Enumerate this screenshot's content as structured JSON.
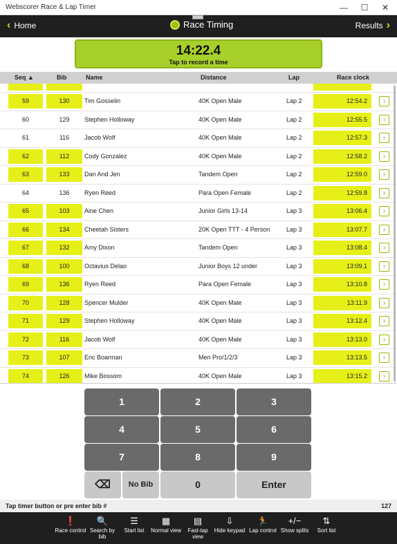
{
  "window": {
    "title": "Webscorer Race & Lap Timer",
    "minimize": "—",
    "maximize": "☐",
    "close": "✕"
  },
  "appbar": {
    "home_label": "Home",
    "title": "Race Timing",
    "results_label": "Results"
  },
  "timer": {
    "time": "14:22.4",
    "instruction": "Tap to record a time"
  },
  "table": {
    "headers": {
      "seq": "Seq ▲",
      "bib": "Bib",
      "name": "Name",
      "distance": "Distance",
      "lap": "Lap",
      "clock": "Race clock"
    },
    "rows": [
      {
        "seq": "59",
        "bib": "130",
        "name": "Tim Gosselin",
        "distance": "40K Open Male",
        "lap": "Lap 2",
        "clock": "12:54.2",
        "hl": true
      },
      {
        "seq": "60",
        "bib": "129",
        "name": "Stephen Holloway",
        "distance": "40K Open Male",
        "lap": "Lap 2",
        "clock": "12:55.5",
        "hl": false
      },
      {
        "seq": "61",
        "bib": "116",
        "name": "Jacob Wolf",
        "distance": "40K Open Male",
        "lap": "Lap 2",
        "clock": "12:57.3",
        "hl": false
      },
      {
        "seq": "62",
        "bib": "112",
        "name": "Cody Gonzalez",
        "distance": "40K Open Male",
        "lap": "Lap 2",
        "clock": "12:58.2",
        "hl": true
      },
      {
        "seq": "63",
        "bib": "133",
        "name": "Dan And Jen",
        "distance": "Tandem Open",
        "lap": "Lap 2",
        "clock": "12:59.0",
        "hl": true
      },
      {
        "seq": "64",
        "bib": "136",
        "name": "Ryen Reed",
        "distance": "Para Open Female",
        "lap": "Lap 2",
        "clock": "12:59.8",
        "hl": false
      },
      {
        "seq": "65",
        "bib": "103",
        "name": "Aine Chen",
        "distance": "Junior Girls 13-14",
        "lap": "Lap 3",
        "clock": "13:06.4",
        "hl": true
      },
      {
        "seq": "66",
        "bib": "134",
        "name": "Cheetah Sisters",
        "distance": "20K Open TTT - 4 Person",
        "lap": "Lap 3",
        "clock": "13:07.7",
        "hl": true
      },
      {
        "seq": "67",
        "bib": "132",
        "name": "Amy Dixon",
        "distance": "Tandem Open",
        "lap": "Lap 3",
        "clock": "13:08.4",
        "hl": true
      },
      {
        "seq": "68",
        "bib": "100",
        "name": "Octavius Delao",
        "distance": "Junior Boys 12 under",
        "lap": "Lap 3",
        "clock": "13:09.1",
        "hl": true
      },
      {
        "seq": "69",
        "bib": "136",
        "name": "Ryen Reed",
        "distance": "Para Open Female",
        "lap": "Lap 3",
        "clock": "13:10.8",
        "hl": true
      },
      {
        "seq": "70",
        "bib": "128",
        "name": "Spencer Mulder",
        "distance": "40K Open Male",
        "lap": "Lap 3",
        "clock": "13:11.9",
        "hl": true
      },
      {
        "seq": "71",
        "bib": "129",
        "name": "Stephen Holloway",
        "distance": "40K Open Male",
        "lap": "Lap 3",
        "clock": "13:12.4",
        "hl": true
      },
      {
        "seq": "72",
        "bib": "116",
        "name": "Jacob Wolf",
        "distance": "40K Open Male",
        "lap": "Lap 3",
        "clock": "13:13.0",
        "hl": true
      },
      {
        "seq": "73",
        "bib": "107",
        "name": "Eric Boarman",
        "distance": "Men Pro/1/2/3",
        "lap": "Lap 3",
        "clock": "13:13.5",
        "hl": true
      },
      {
        "seq": "74",
        "bib": "126",
        "name": "Mike Bossom",
        "distance": "40K Open Male",
        "lap": "Lap 3",
        "clock": "13:15.2",
        "hl": true
      }
    ]
  },
  "keypad": {
    "keys": [
      "1",
      "2",
      "3",
      "4",
      "5",
      "6",
      "7",
      "8",
      "9"
    ],
    "backspace": "⌫",
    "no_bib": "No Bib",
    "zero": "0",
    "enter": "Enter"
  },
  "status": {
    "message": "Tap timer button or pre enter bib #",
    "count": "127"
  },
  "toolbar": [
    {
      "icon": "alert-icon",
      "glyph": "❗",
      "label": "Race control"
    },
    {
      "icon": "search-icon",
      "glyph": "🔍",
      "label": "Search by bib"
    },
    {
      "icon": "start-list-icon",
      "glyph": "☰",
      "label": "Start list"
    },
    {
      "icon": "normal-view-icon",
      "glyph": "▦",
      "label": "Normal view"
    },
    {
      "icon": "fast-tap-icon",
      "glyph": "▤",
      "label": "Fast-tap view"
    },
    {
      "icon": "hide-keypad-icon",
      "glyph": "⇩",
      "label": "Hide keypad"
    },
    {
      "icon": "runner-icon",
      "glyph": "🏃",
      "label": "Lap control"
    },
    {
      "icon": "splits-icon",
      "glyph": "+/−",
      "label": "Show splits"
    },
    {
      "icon": "sort-icon",
      "glyph": "⇅",
      "label": "Sort list"
    }
  ]
}
